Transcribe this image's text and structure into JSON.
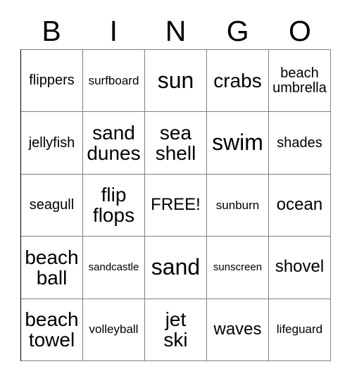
{
  "header": {
    "letters": [
      "B",
      "I",
      "N",
      "G",
      "O"
    ]
  },
  "grid": {
    "rows": 5,
    "columns": 5,
    "border_color": "#808080",
    "background_color": "#ffffff",
    "text_color": "#000000",
    "cells": [
      {
        "text": "flippers",
        "size": "fs-m"
      },
      {
        "text": "surfboard",
        "size": "fs-s"
      },
      {
        "text": "sun",
        "size": "fs-xxl"
      },
      {
        "text": "crabs",
        "size": "fs-xl"
      },
      {
        "text": "beach\numbrella",
        "size": "fs-m"
      },
      {
        "text": "jellyfish",
        "size": "fs-m"
      },
      {
        "text": "sand\ndunes",
        "size": "fs-xl"
      },
      {
        "text": "sea\nshell",
        "size": "fs-xl"
      },
      {
        "text": "swim",
        "size": "fs-xxl"
      },
      {
        "text": "shades",
        "size": "fs-m"
      },
      {
        "text": "seagull",
        "size": "fs-m"
      },
      {
        "text": "flip\nflops",
        "size": "fs-xl"
      },
      {
        "text": "FREE!",
        "size": "fs-l"
      },
      {
        "text": "sunburn",
        "size": "fs-s"
      },
      {
        "text": "ocean",
        "size": "fs-l"
      },
      {
        "text": "beach\nball",
        "size": "fs-xl"
      },
      {
        "text": "sandcastle",
        "size": "fs-xs"
      },
      {
        "text": "sand",
        "size": "fs-xxl"
      },
      {
        "text": "sunscreen",
        "size": "fs-xs"
      },
      {
        "text": "shovel",
        "size": "fs-l"
      },
      {
        "text": "beach\ntowel",
        "size": "fs-xl"
      },
      {
        "text": "volleyball",
        "size": "fs-s"
      },
      {
        "text": "jet\nski",
        "size": "fs-xl"
      },
      {
        "text": "waves",
        "size": "fs-l"
      },
      {
        "text": "lifeguard",
        "size": "fs-s"
      }
    ],
    "free_space_index": 12
  }
}
